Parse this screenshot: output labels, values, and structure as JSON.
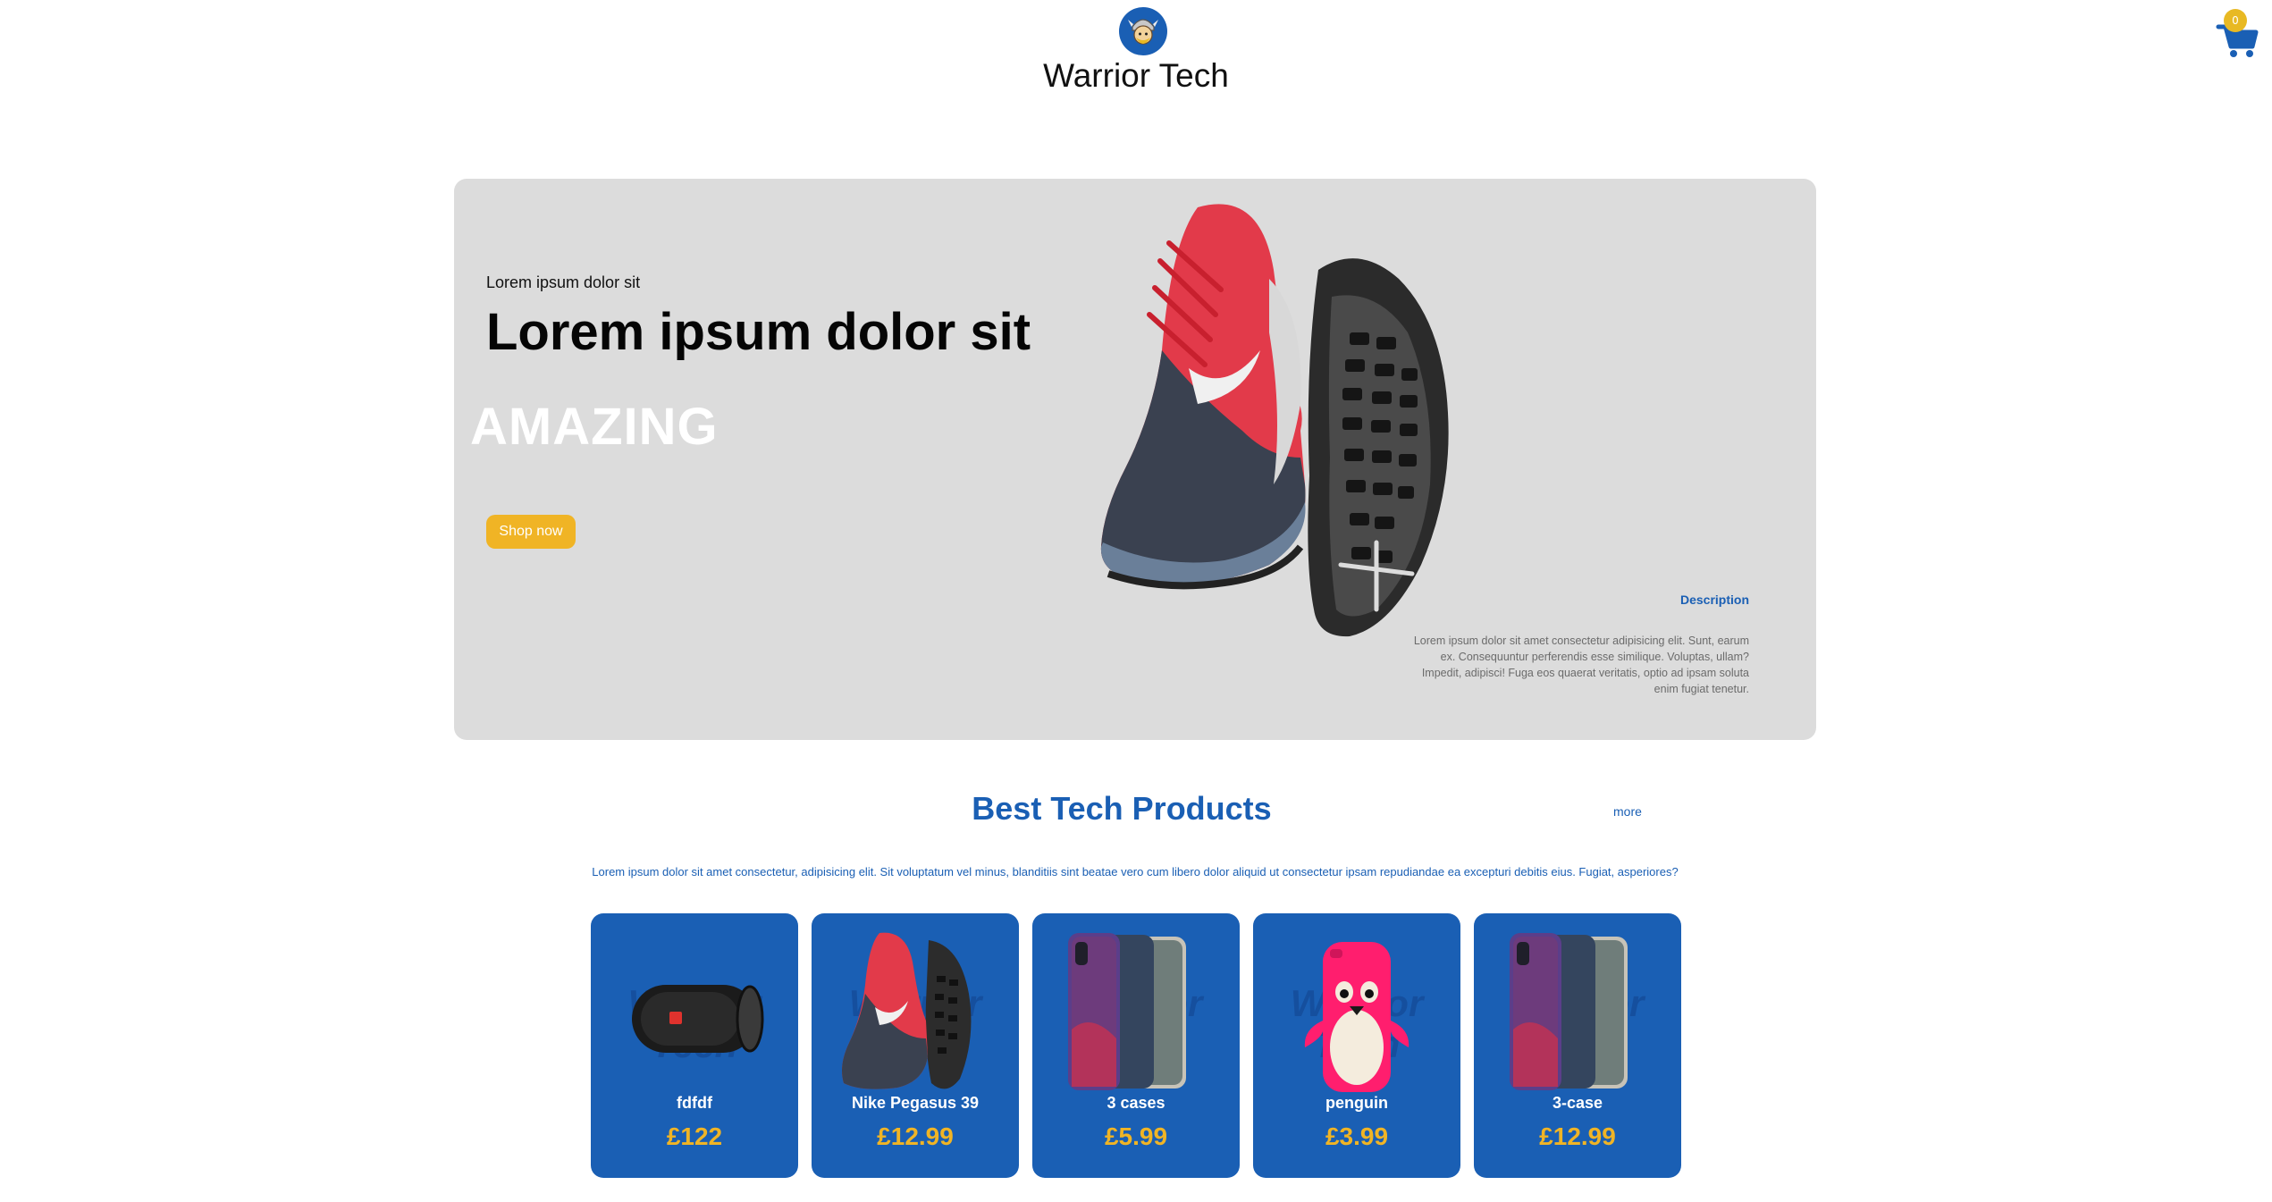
{
  "header": {
    "brand": "Warrior Tech",
    "cart_count": "0"
  },
  "hero": {
    "small_text": "Lorem ipsum dolor sit",
    "title": "Lorem ipsum dolor sit",
    "highlight": "AMAZING",
    "button_label": "Shop now",
    "description_title": "Description",
    "description": "Lorem ipsum dolor sit amet consectetur adipisicing elit. Sunt, earum ex. Consequuntur perferendis esse similique. Voluptas, ullam? Impedit, adipisci! Fuga eos quaerat veritatis, optio ad ipsam soluta enim fugiat tenetur."
  },
  "section": {
    "title": "Best Tech Products",
    "more_label": "more",
    "description": "Lorem ipsum dolor sit amet consectetur, adipisicing elit. Sit voluptatum vel minus, blanditiis sint beatae vero cum libero dolor aliquid ut consectetur ipsam repudiandae ea excepturi debitis eius. Fugiat, asperiores?"
  },
  "products": [
    {
      "name": "fdfdf",
      "price": "£122",
      "image": "speaker"
    },
    {
      "name": "Nike Pegasus 39",
      "price": "£12.99",
      "image": "shoe"
    },
    {
      "name": "3 cases",
      "price": "£5.99",
      "image": "phone-cases"
    },
    {
      "name": "penguin",
      "price": "£3.99",
      "image": "penguin-case"
    },
    {
      "name": "3-case",
      "price": "£12.99",
      "image": "phone-cases"
    }
  ],
  "colors": {
    "brand_blue": "#1a5fb4",
    "accent_yellow": "#f0b425",
    "hero_bg": "#dcdcdc"
  }
}
